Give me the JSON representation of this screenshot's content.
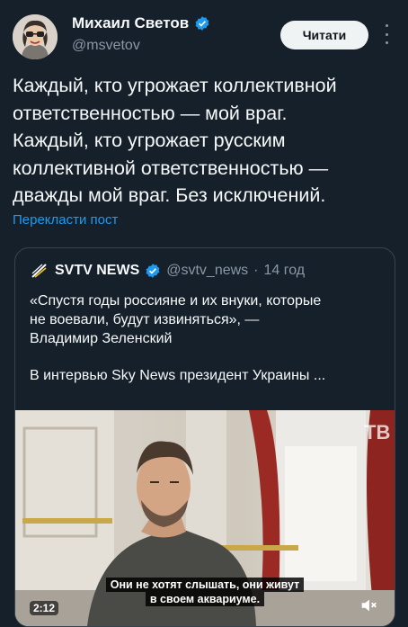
{
  "author": {
    "name": "Михаил Светов",
    "handle": "@msvetov",
    "verified": true
  },
  "follow_button": {
    "label": "Читати"
  },
  "tweet": {
    "lines": [
      "Каждый, кто угрожает коллективной",
      "ответственностью  — мой враг.",
      "Каждый, кто угрожает русским",
      "коллективной ответственностью —",
      "дважды мой враг. Без исключений."
    ],
    "translate_link": "Перекласти пост"
  },
  "quote": {
    "name": "SVTV NEWS",
    "handle": "@svtv_news",
    "separator": "·",
    "time": "14 год",
    "lines": [
      "«Спустя годы россияне и их внуки, которые",
      "не воевали, будут извиняться», —",
      "Владимир Зеленский"
    ],
    "second_paragraph": "В интервью Sky News президент Украины ...",
    "video": {
      "watermark": "TB",
      "subtitle_lines": [
        "Они не хотят слышать, они живут",
        "в своем аквариуме."
      ],
      "duration": "2:12",
      "sound_icon": "speaker-muted-icon"
    }
  },
  "colors": {
    "background": "#15202b",
    "link": "#1d9bf0",
    "secondary_text": "#8b98a5",
    "verified": "#1d9bf0",
    "border": "#38444d"
  }
}
